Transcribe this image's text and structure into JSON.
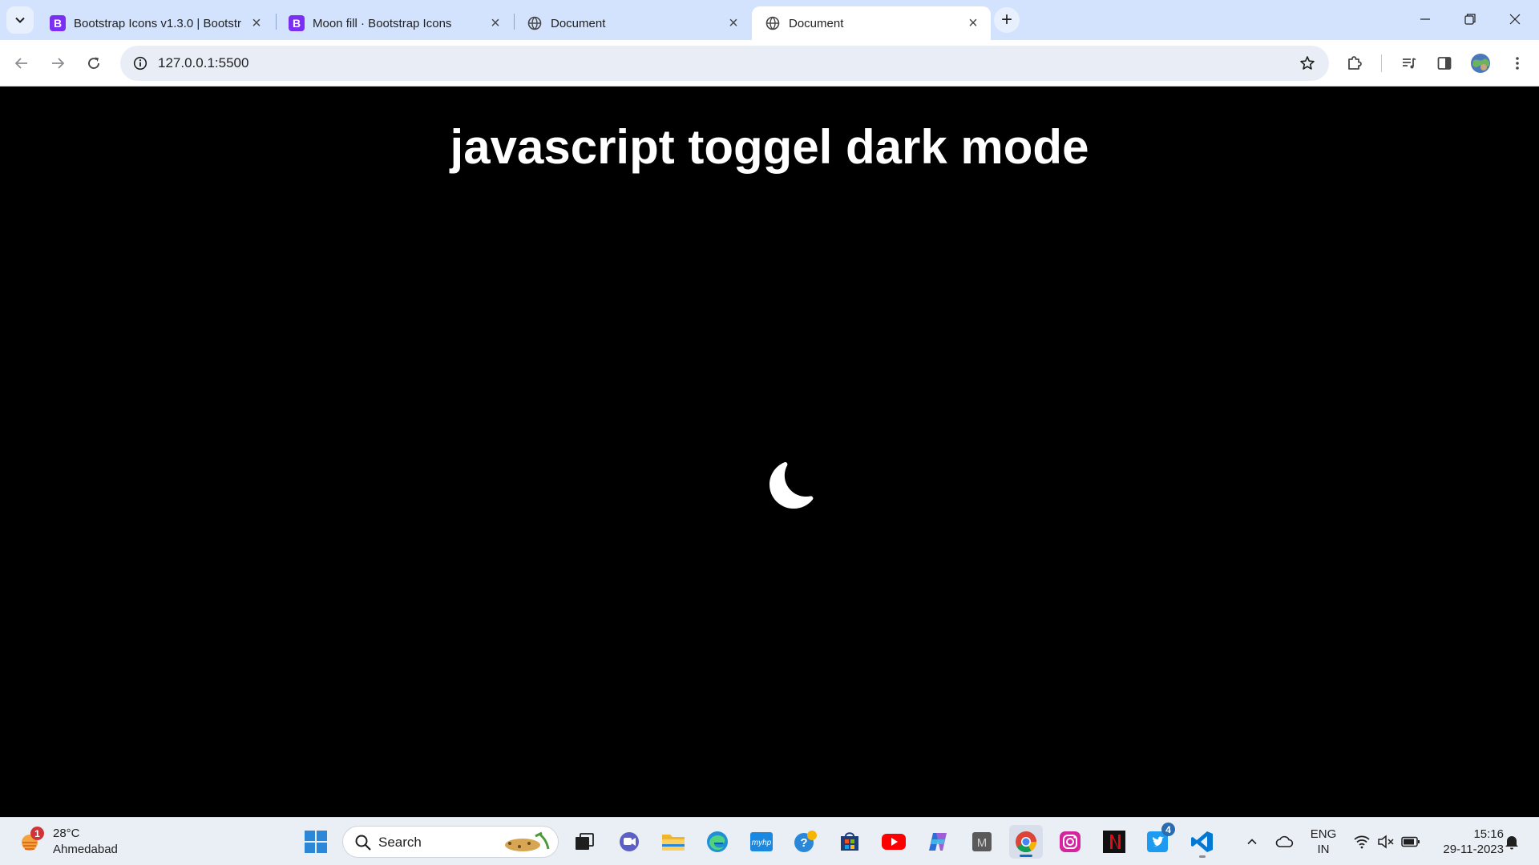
{
  "browser": {
    "tabs": [
      {
        "title": "Bootstrap Icons v1.3.0 | Bootstr",
        "favicon": "bootstrap-icon",
        "active": false
      },
      {
        "title": "Moon fill · Bootstrap Icons",
        "favicon": "bootstrap-icon",
        "active": false
      },
      {
        "title": "Document",
        "favicon": "globe-icon",
        "active": false
      },
      {
        "title": "Document",
        "favicon": "globe-icon",
        "active": true
      }
    ],
    "favicon_letter": "B",
    "url": "127.0.0.1:5500",
    "accent": "#d3e3fd",
    "omnibox_bg": "#e9eef6"
  },
  "page": {
    "heading": "javascript toggel dark mode",
    "background": "#000000",
    "text_color": "#ffffff",
    "theme_toggle_icon": "moon-fill-icon"
  },
  "taskbar": {
    "weather": {
      "temp": "28°C",
      "city": "Ahmedabad",
      "alert_count": "1"
    },
    "search_label": "Search",
    "twitter_badge": "4",
    "language": {
      "line1": "ENG",
      "line2": "IN"
    },
    "clock": {
      "time": "15:16",
      "date": "29-11-2023"
    },
    "apps": [
      "windows-start-icon",
      "task-view-icon",
      "teams-icon",
      "file-explorer-icon",
      "edge-icon",
      "myhp-icon",
      "get-help-icon",
      "microsoft-store-icon",
      "youtube-icon",
      "copilot-icon",
      "mail-icon",
      "chrome-icon",
      "instagram-icon",
      "netflix-icon",
      "twitter-icon",
      "vscode-icon"
    ]
  }
}
